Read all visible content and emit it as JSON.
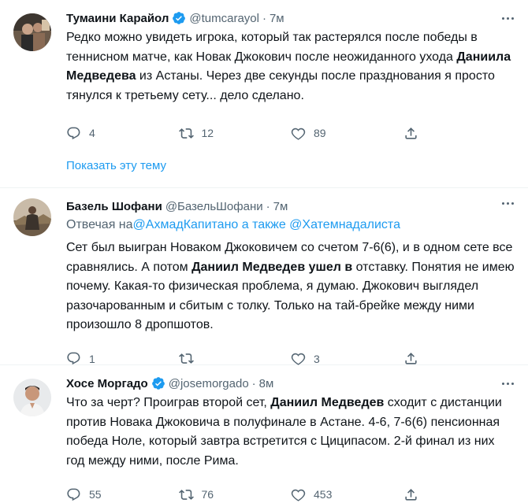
{
  "tweets": [
    {
      "name": "Тумаини Карайол",
      "handle": "@tumcarayol",
      "time": "7м",
      "text_parts": [
        "Редко можно увидеть игрока, который так растерялся после победы в теннисном матче, как Новак Джокович после неожиданного ухода ",
        "Даниила Медведева",
        " из Астаны. Через две секунды после празднования я просто тянулся к третьему сету... дело сделано."
      ],
      "replies": "4",
      "retweets": "12",
      "likes": "89",
      "show_thread": "Показать эту тему"
    },
    {
      "name": "Базель Шофани",
      "handle": "@БазельШофани",
      "time": "7м",
      "reply_prefix": "Отвечая на",
      "reply_targets": "@АхмадКапитано а также @Хатемнадалиста",
      "text_parts": [
        "Сет был выигран Новаком Джоковичем со счетом 7-6(6), и в одном сете все сравнялись. А потом ",
        "Даниил Медведев ушел в",
        " отставку. Понятия не имею почему. Какая-то физическая проблема, я думаю. Джокович выглядел разочарованным и сбитым с толку. Только на тай-брейке между ними произошло 8 дропшотов."
      ],
      "replies": "1",
      "retweets": "",
      "likes": "3"
    },
    {
      "name": "Хосе Моргадо",
      "handle": "@josemorgado",
      "time": "8м",
      "text_parts": [
        "Что за черт? Проиграв второй сет, ",
        "Даниил Медведев",
        " сходит с дистанции против Новака Джоковича в полуфинале в Астане. 4-6, 7-6(6) пенсионная победа Ноле, который завтра встретится с Циципасом. 2-й финал из них год между ними, после Рима."
      ],
      "replies": "55",
      "retweets": "76",
      "likes": "453"
    }
  ],
  "icons": {
    "verified": "verified-badge-icon",
    "reply": "comment-icon",
    "retweet": "retweet-icon",
    "like": "heart-icon",
    "share": "share-icon",
    "more": "more-icon"
  },
  "colors": {
    "accent": "#1d9bf0",
    "secondary_text": "#536471",
    "divider": "#eff3f4"
  }
}
